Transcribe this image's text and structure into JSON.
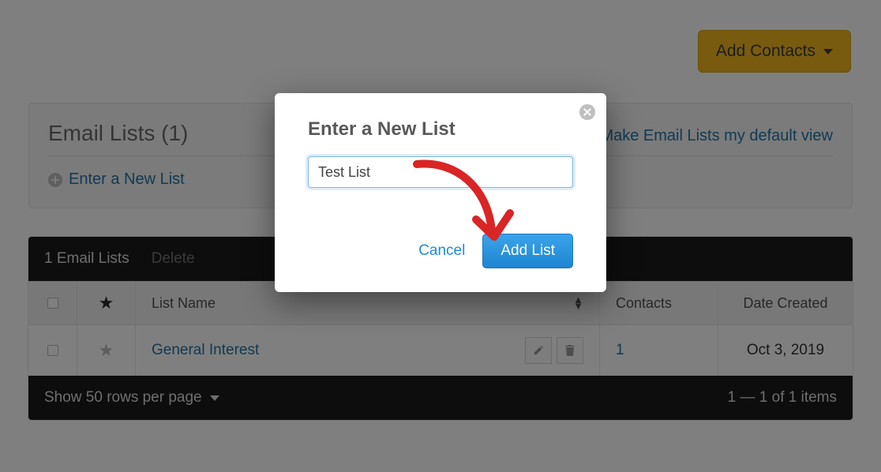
{
  "topbar": {
    "add_contacts_label": "Add Contacts"
  },
  "card": {
    "title": "Email Lists (1)",
    "default_view_link": "Make Email Lists my default view",
    "new_list_link": "Enter a New List"
  },
  "table": {
    "toolbar_count": "1 Email Lists",
    "delete_label": "Delete",
    "headers": {
      "name": "List Name",
      "contacts": "Contacts",
      "date": "Date Created"
    },
    "rows": [
      {
        "name": "General Interest",
        "contacts": "1",
        "date": "Oct 3, 2019"
      }
    ],
    "footer_rows": "Show 50 rows per page",
    "footer_count": "1 — 1 of 1 items"
  },
  "modal": {
    "title": "Enter a New List",
    "input_value": "Test List",
    "cancel": "Cancel",
    "submit": "Add List"
  }
}
